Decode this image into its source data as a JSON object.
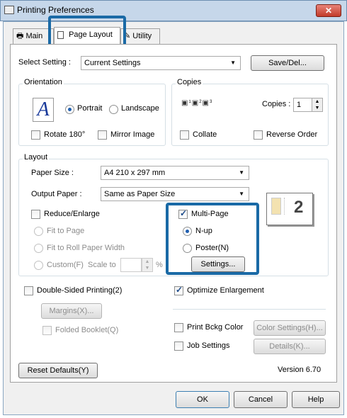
{
  "window": {
    "title": "Printing Preferences",
    "close_label": "✕"
  },
  "tabs": [
    {
      "label": "Main"
    },
    {
      "label": "Page Layout"
    },
    {
      "label": "Utility"
    }
  ],
  "select_setting": {
    "label": "Select Setting :",
    "value": "Current Settings",
    "button": "Save/Del..."
  },
  "orientation": {
    "title": "Orientation",
    "portrait": "Portrait",
    "landscape": "Landscape",
    "rotate180": "Rotate 180°",
    "mirror": "Mirror Image"
  },
  "copies": {
    "title": "Copies",
    "label": "Copies :",
    "value": "1",
    "collate": "Collate",
    "reverse": "Reverse Order"
  },
  "layout": {
    "title": "Layout",
    "paper_size_label": "Paper Size :",
    "paper_size_value": "A4 210 x 297 mm",
    "output_paper_label": "Output Paper :",
    "output_paper_value": "Same as Paper Size",
    "reduce_enlarge": "Reduce/Enlarge",
    "fit_to_page": "Fit to Page",
    "fit_to_roll": "Fit to Roll Paper Width",
    "custom": "Custom(F)",
    "scale_to": "Scale to",
    "percent": "%",
    "multi_page": "Multi-Page",
    "nup": "N-up",
    "poster": "Poster(N)",
    "settings_button": "Settings...",
    "preview_number": "2"
  },
  "double_sided": {
    "label": "Double-Sided Printing(2)",
    "margins": "Margins(X)...",
    "folded": "Folded Booklet(Q)"
  },
  "optimize": {
    "label": "Optimize Enlargement"
  },
  "print_bckg": {
    "label": "Print Bckg Color",
    "button": "Color Settings(H)..."
  },
  "job": {
    "label": "Job Settings",
    "button": "Details(K)..."
  },
  "footer": {
    "reset": "Reset Defaults(Y)",
    "version": "Version 6.70"
  },
  "dialog_buttons": {
    "ok": "OK",
    "cancel": "Cancel",
    "help": "Help"
  },
  "colors": {
    "highlight": "#1a6aa6",
    "accent": "#1f5fb0"
  }
}
